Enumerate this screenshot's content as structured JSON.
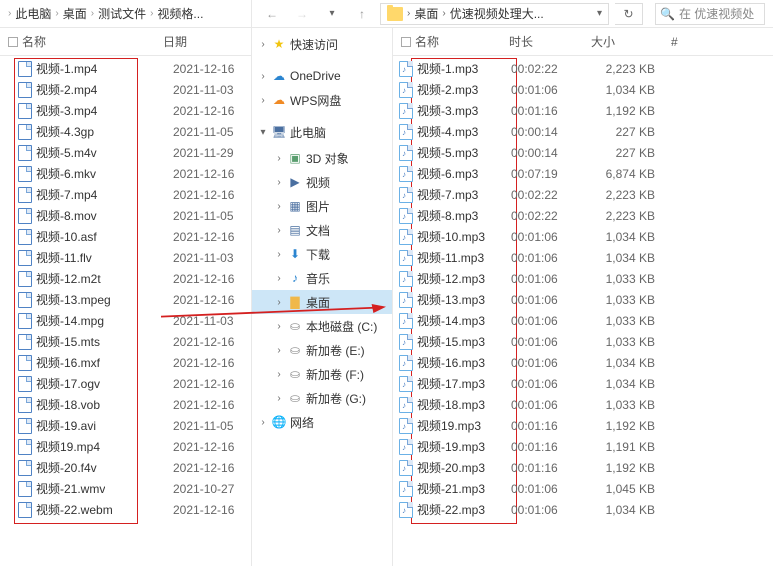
{
  "left_crumbs": [
    "此电脑",
    "桌面",
    "测试文件",
    "视频格..."
  ],
  "right_path": [
    "桌面",
    "优速视频处理大..."
  ],
  "search_placeholder": "在 优速视频处",
  "headers_left": {
    "name": "名称",
    "date": "日期"
  },
  "headers_right": {
    "name": "名称",
    "duration": "时长",
    "size": "大小",
    "num": "#"
  },
  "left_files": [
    {
      "name": "视频-1.mp4",
      "date": "2021-12-16"
    },
    {
      "name": "视频-2.mp4",
      "date": "2021-11-03"
    },
    {
      "name": "视频-3.mp4",
      "date": "2021-12-16"
    },
    {
      "name": "视频-4.3gp",
      "date": "2021-11-05"
    },
    {
      "name": "视频-5.m4v",
      "date": "2021-11-29"
    },
    {
      "name": "视频-6.mkv",
      "date": "2021-12-16"
    },
    {
      "name": "视频-7.mp4",
      "date": "2021-12-16"
    },
    {
      "name": "视频-8.mov",
      "date": "2021-11-05"
    },
    {
      "name": "视频-10.asf",
      "date": "2021-12-16"
    },
    {
      "name": "视频-11.flv",
      "date": "2021-11-03"
    },
    {
      "name": "视频-12.m2t",
      "date": "2021-12-16"
    },
    {
      "name": "视频-13.mpeg",
      "date": "2021-12-16"
    },
    {
      "name": "视频-14.mpg",
      "date": "2021-11-03"
    },
    {
      "name": "视频-15.mts",
      "date": "2021-12-16"
    },
    {
      "name": "视频-16.mxf",
      "date": "2021-12-16"
    },
    {
      "name": "视频-17.ogv",
      "date": "2021-12-16"
    },
    {
      "name": "视频-18.vob",
      "date": "2021-12-16"
    },
    {
      "name": "视频-19.avi",
      "date": "2021-11-05"
    },
    {
      "name": "视频19.mp4",
      "date": "2021-12-16"
    },
    {
      "name": "视频-20.f4v",
      "date": "2021-12-16"
    },
    {
      "name": "视频-21.wmv",
      "date": "2021-10-27"
    },
    {
      "name": "视频-22.webm",
      "date": "2021-12-16"
    }
  ],
  "right_files": [
    {
      "name": "视频-1.mp3",
      "dur": "00:02:22",
      "size": "2,223 KB"
    },
    {
      "name": "视频-2.mp3",
      "dur": "00:01:06",
      "size": "1,034 KB"
    },
    {
      "name": "视频-3.mp3",
      "dur": "00:01:16",
      "size": "1,192 KB"
    },
    {
      "name": "视频-4.mp3",
      "dur": "00:00:14",
      "size": "227 KB"
    },
    {
      "name": "视频-5.mp3",
      "dur": "00:00:14",
      "size": "227 KB"
    },
    {
      "name": "视频-6.mp3",
      "dur": "00:07:19",
      "size": "6,874 KB"
    },
    {
      "name": "视频-7.mp3",
      "dur": "00:02:22",
      "size": "2,223 KB"
    },
    {
      "name": "视频-8.mp3",
      "dur": "00:02:22",
      "size": "2,223 KB"
    },
    {
      "name": "视频-10.mp3",
      "dur": "00:01:06",
      "size": "1,034 KB"
    },
    {
      "name": "视频-11.mp3",
      "dur": "00:01:06",
      "size": "1,034 KB"
    },
    {
      "name": "视频-12.mp3",
      "dur": "00:01:06",
      "size": "1,033 KB"
    },
    {
      "name": "视频-13.mp3",
      "dur": "00:01:06",
      "size": "1,033 KB"
    },
    {
      "name": "视频-14.mp3",
      "dur": "00:01:06",
      "size": "1,033 KB"
    },
    {
      "name": "视频-15.mp3",
      "dur": "00:01:06",
      "size": "1,033 KB"
    },
    {
      "name": "视频-16.mp3",
      "dur": "00:01:06",
      "size": "1,034 KB"
    },
    {
      "name": "视频-17.mp3",
      "dur": "00:01:06",
      "size": "1,034 KB"
    },
    {
      "name": "视频-18.mp3",
      "dur": "00:01:06",
      "size": "1,033 KB"
    },
    {
      "name": "视频19.mp3",
      "dur": "00:01:16",
      "size": "1,192 KB"
    },
    {
      "name": "视频-19.mp3",
      "dur": "00:01:16",
      "size": "1,191 KB"
    },
    {
      "name": "视频-20.mp3",
      "dur": "00:01:16",
      "size": "1,192 KB"
    },
    {
      "name": "视频-21.mp3",
      "dur": "00:01:06",
      "size": "1,045 KB"
    },
    {
      "name": "视频-22.mp3",
      "dur": "00:01:06",
      "size": "1,034 KB"
    }
  ],
  "tree": [
    {
      "chev": "",
      "icon": "star",
      "label": "快速访问",
      "cls": ""
    },
    {
      "chev": "",
      "icon": "cloud-blue",
      "label": "OneDrive",
      "cls": ""
    },
    {
      "chev": "",
      "icon": "cloud-orange",
      "label": "WPS网盘",
      "cls": ""
    },
    {
      "chev": "▾",
      "icon": "monitor",
      "label": "此电脑",
      "cls": ""
    },
    {
      "chev": "",
      "icon": "cube",
      "label": "3D 对象",
      "cls": "sub"
    },
    {
      "chev": "",
      "icon": "vid",
      "label": "视频",
      "cls": "sub"
    },
    {
      "chev": "",
      "icon": "pic",
      "label": "图片",
      "cls": "sub"
    },
    {
      "chev": "",
      "icon": "doc",
      "label": "文档",
      "cls": "sub"
    },
    {
      "chev": "",
      "icon": "dl",
      "label": "下载",
      "cls": "sub"
    },
    {
      "chev": "",
      "icon": "music",
      "label": "音乐",
      "cls": "sub"
    },
    {
      "chev": "",
      "icon": "folderc",
      "label": "桌面",
      "cls": "sub selected"
    },
    {
      "chev": "",
      "icon": "disk",
      "label": "本地磁盘 (C:)",
      "cls": "sub"
    },
    {
      "chev": "",
      "icon": "disk",
      "label": "新加卷 (E:)",
      "cls": "sub"
    },
    {
      "chev": "",
      "icon": "disk",
      "label": "新加卷 (F:)",
      "cls": "sub"
    },
    {
      "chev": "",
      "icon": "disk",
      "label": "新加卷 (G:)",
      "cls": "sub"
    },
    {
      "chev": "",
      "icon": "globe",
      "label": "网络",
      "cls": ""
    }
  ]
}
